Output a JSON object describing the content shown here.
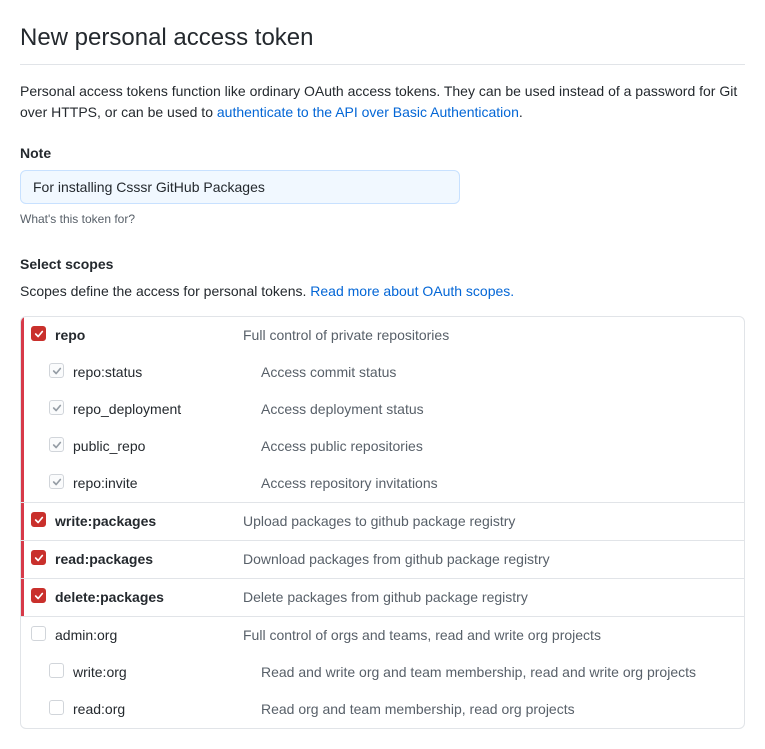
{
  "title": "New personal access token",
  "description_pre": "Personal access tokens function like ordinary OAuth access tokens. They can be used instead of a password for Git over HTTPS, or can be used to ",
  "description_link": "authenticate to the API over Basic Authentication",
  "description_post": ".",
  "note": {
    "label": "Note",
    "value": "For installing Csssr GitHub Packages",
    "hint": "What's this token for?"
  },
  "scopes_section": {
    "header": "Select scopes",
    "desc_pre": "Scopes define the access for personal tokens. ",
    "desc_link": "Read more about OAuth scopes."
  },
  "scopes": [
    {
      "highlighted": true,
      "rows": [
        {
          "label": "repo",
          "desc": "Full control of private repositories",
          "bold": true,
          "state": "checked",
          "child": false
        },
        {
          "label": "repo:status",
          "desc": "Access commit status",
          "bold": false,
          "state": "checked-grey",
          "child": true
        },
        {
          "label": "repo_deployment",
          "desc": "Access deployment status",
          "bold": false,
          "state": "checked-grey",
          "child": true
        },
        {
          "label": "public_repo",
          "desc": "Access public repositories",
          "bold": false,
          "state": "checked-grey",
          "child": true
        },
        {
          "label": "repo:invite",
          "desc": "Access repository invitations",
          "bold": false,
          "state": "checked-grey",
          "child": true
        }
      ]
    },
    {
      "highlighted": true,
      "rows": [
        {
          "label": "write:packages",
          "desc": "Upload packages to github package registry",
          "bold": true,
          "state": "checked",
          "child": false
        }
      ]
    },
    {
      "highlighted": true,
      "rows": [
        {
          "label": "read:packages",
          "desc": "Download packages from github package registry",
          "bold": true,
          "state": "checked",
          "child": false
        }
      ]
    },
    {
      "highlighted": true,
      "rows": [
        {
          "label": "delete:packages",
          "desc": "Delete packages from github package registry",
          "bold": true,
          "state": "checked",
          "child": false
        }
      ]
    },
    {
      "highlighted": false,
      "rows": [
        {
          "label": "admin:org",
          "desc": "Full control of orgs and teams, read and write org projects",
          "bold": false,
          "state": "unchecked",
          "child": false
        },
        {
          "label": "write:org",
          "desc": "Read and write org and team membership, read and write org projects",
          "bold": false,
          "state": "unchecked",
          "child": true
        },
        {
          "label": "read:org",
          "desc": "Read org and team membership, read org projects",
          "bold": false,
          "state": "unchecked",
          "child": true
        }
      ]
    }
  ]
}
